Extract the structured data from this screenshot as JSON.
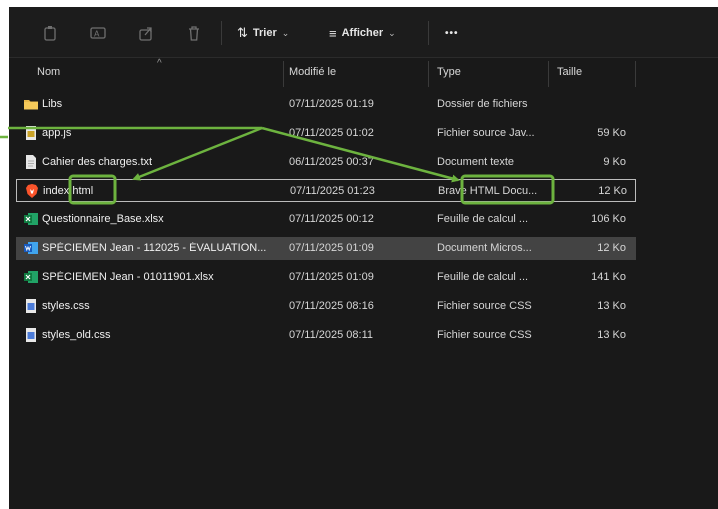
{
  "toolbar": {
    "sort_label": "Trier",
    "view_label": "Afficher",
    "more_label": "•••"
  },
  "columns": {
    "name": "Nom",
    "modified": "Modifié le",
    "type": "Type",
    "size": "Taille"
  },
  "files": [
    {
      "name": "Libs",
      "date": "07/11/2025 01:19",
      "type": "Dossier de fichiers",
      "size": "",
      "icon": "folder-icon"
    },
    {
      "name": "app.js",
      "date": "07/11/2025 01:02",
      "type": "Fichier source Jav...",
      "size": "59 Ko",
      "icon": "js-file-icon"
    },
    {
      "name": "Cahier des charges.txt",
      "date": "06/11/2025 00:37",
      "type": "Document texte",
      "size": "9 Ko",
      "icon": "text-file-icon"
    },
    {
      "name": "index.html",
      "date": "07/11/2025 01:23",
      "type": "Brave HTML Docu...",
      "size": "12 Ko",
      "icon": "brave-html-icon"
    },
    {
      "name": "Questionnaire_Base.xlsx",
      "date": "07/11/2025 00:12",
      "type": "Feuille de calcul ...",
      "size": "106 Ko",
      "icon": "excel-file-icon"
    },
    {
      "name": "SPÉCIEMEN Jean - 112025 - ÉVALUATION...",
      "date": "07/11/2025 01:09",
      "type": "Document Micros...",
      "size": "12 Ko",
      "icon": "word-file-icon"
    },
    {
      "name": "SPÉCIEMEN Jean - 01011901.xlsx",
      "date": "07/11/2025 01:09",
      "type": "Feuille de calcul ...",
      "size": "141 Ko",
      "icon": "excel-file-icon"
    },
    {
      "name": "styles.css",
      "date": "07/11/2025 08:16",
      "type": "Fichier source CSS",
      "size": "13 Ko",
      "icon": "css-file-icon"
    },
    {
      "name": "styles_old.css",
      "date": "07/11/2025 08:11",
      "type": "Fichier source CSS",
      "size": "13 Ko",
      "icon": "css-file-icon"
    }
  ],
  "colors": {
    "background": "#191919",
    "selected_row": "#434343",
    "annotation": "#6db33f"
  }
}
